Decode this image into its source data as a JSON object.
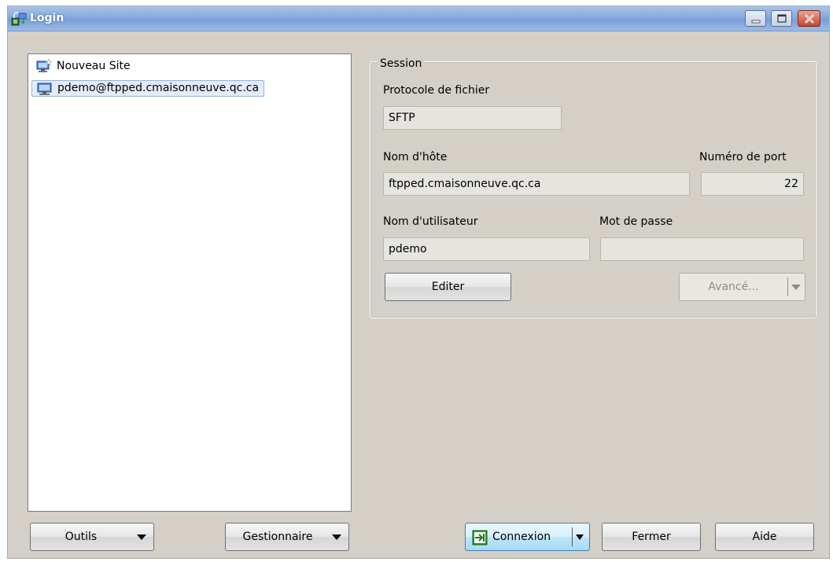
{
  "window": {
    "title": "Login"
  },
  "site_tree": {
    "items": [
      {
        "label": "Nouveau Site",
        "icon": "new-site-icon",
        "selected": false
      },
      {
        "label": "pdemo@ftpped.cmaisonneuve.qc.ca",
        "icon": "computer-icon",
        "selected": true
      }
    ]
  },
  "session": {
    "legend": "Session",
    "protocol_label": "Protocole de fichier",
    "protocol_value": "SFTP",
    "host_label": "Nom d'hôte",
    "host_value": "ftpped.cmaisonneuve.qc.ca",
    "port_label": "Numéro de port",
    "port_value": "22",
    "user_label": "Nom d'utilisateur",
    "user_value": "pdemo",
    "password_label": "Mot de passe",
    "password_value": "",
    "edit_button": "Editer",
    "advanced_button": "Avancé..."
  },
  "footer": {
    "tools_button": "Outils",
    "manager_button": "Gestionnaire",
    "connect_button": "Connexion",
    "close_button": "Fermer",
    "help_button": "Aide"
  },
  "colors": {
    "titlebar": "#86a9dd",
    "window_bg": "#d4d0c8",
    "selection": "#e3ecf8",
    "connect_accent": "#3c7fb1"
  }
}
